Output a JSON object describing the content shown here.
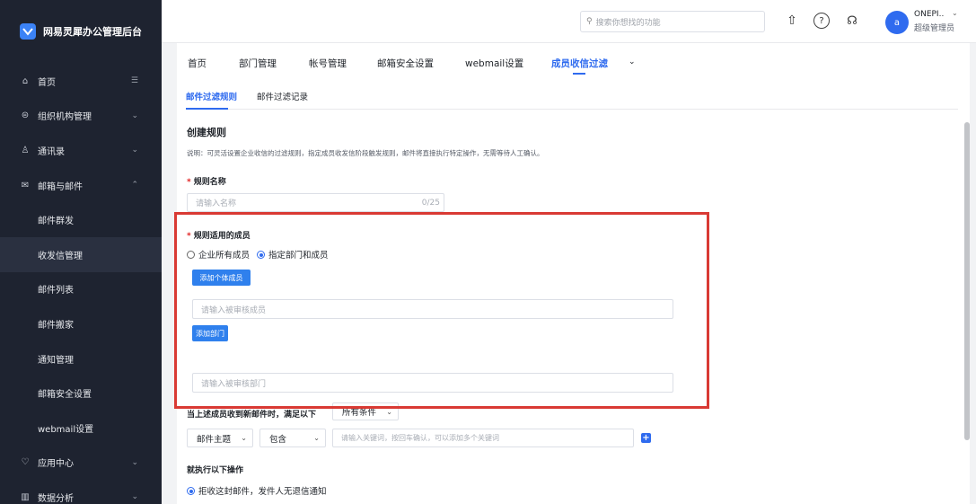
{
  "brand": {
    "title": "网易灵犀办公管理后台"
  },
  "sidebar": {
    "items": [
      {
        "label": "首页",
        "icon": "home-icon",
        "glyph": "⌂",
        "chevron": "☰"
      },
      {
        "label": "组织机构管理",
        "icon": "org-icon",
        "glyph": "⊜",
        "chevron": "⌄"
      },
      {
        "label": "通讯录",
        "icon": "contacts-icon",
        "glyph": "♙",
        "chevron": "⌄"
      },
      {
        "label": "邮箱与邮件",
        "icon": "mail-icon",
        "glyph": "✉",
        "chevron": "⌃"
      },
      {
        "label": "邮件群发"
      },
      {
        "label": "收发信管理"
      },
      {
        "label": "邮件列表"
      },
      {
        "label": "邮件搬家"
      },
      {
        "label": "通知管理"
      },
      {
        "label": "邮箱安全设置"
      },
      {
        "label": "webmail设置"
      },
      {
        "label": "应用中心",
        "icon": "app-center-icon",
        "glyph": "♡",
        "chevron": "⌄"
      },
      {
        "label": "数据分析",
        "icon": "analytics-icon",
        "glyph": "▥",
        "chevron": "⌄"
      }
    ]
  },
  "topbar": {
    "search_placeholder": "搜索你想找的功能",
    "user_initial": "a",
    "user_name": "ONEPI..",
    "user_role": "超级管理员"
  },
  "tabs": [
    "首页",
    "部门管理",
    "帐号管理",
    "邮箱安全设置",
    "webmail设置",
    "成员收信过滤"
  ],
  "subtabs": [
    "邮件过滤规则",
    "邮件过滤记录"
  ],
  "form": {
    "section_title": "创建规则",
    "description": "说明：可灵活设置企业收信的过滤规则，指定成员收发信阶段触发规则，邮件将直接执行特定操作，无需等待人工确认。",
    "rule_name_label": "规则名称",
    "rule_name_placeholder": "请输入名称",
    "rule_name_counter": "0/25",
    "members_label": "规则适用的成员",
    "radio_all": "企业所有成员",
    "radio_specific": "指定部门和成员",
    "add_member_btn": "添加个体成员",
    "member_placeholder": "请输入被审核成员",
    "add_dept_btn": "添加部门",
    "dept_placeholder": "请输入被审核部门",
    "condition_label": "当上述成员收到新邮件时，满足以下",
    "condition_select": "所有条件",
    "field_select": "邮件主题",
    "op_select": "包含",
    "keyword_placeholder": "请输入关键词，按回车确认，可以添加多个关键词",
    "action_label": "就执行以下操作",
    "action_option": "拒收这封邮件，发件人无退信通知"
  }
}
